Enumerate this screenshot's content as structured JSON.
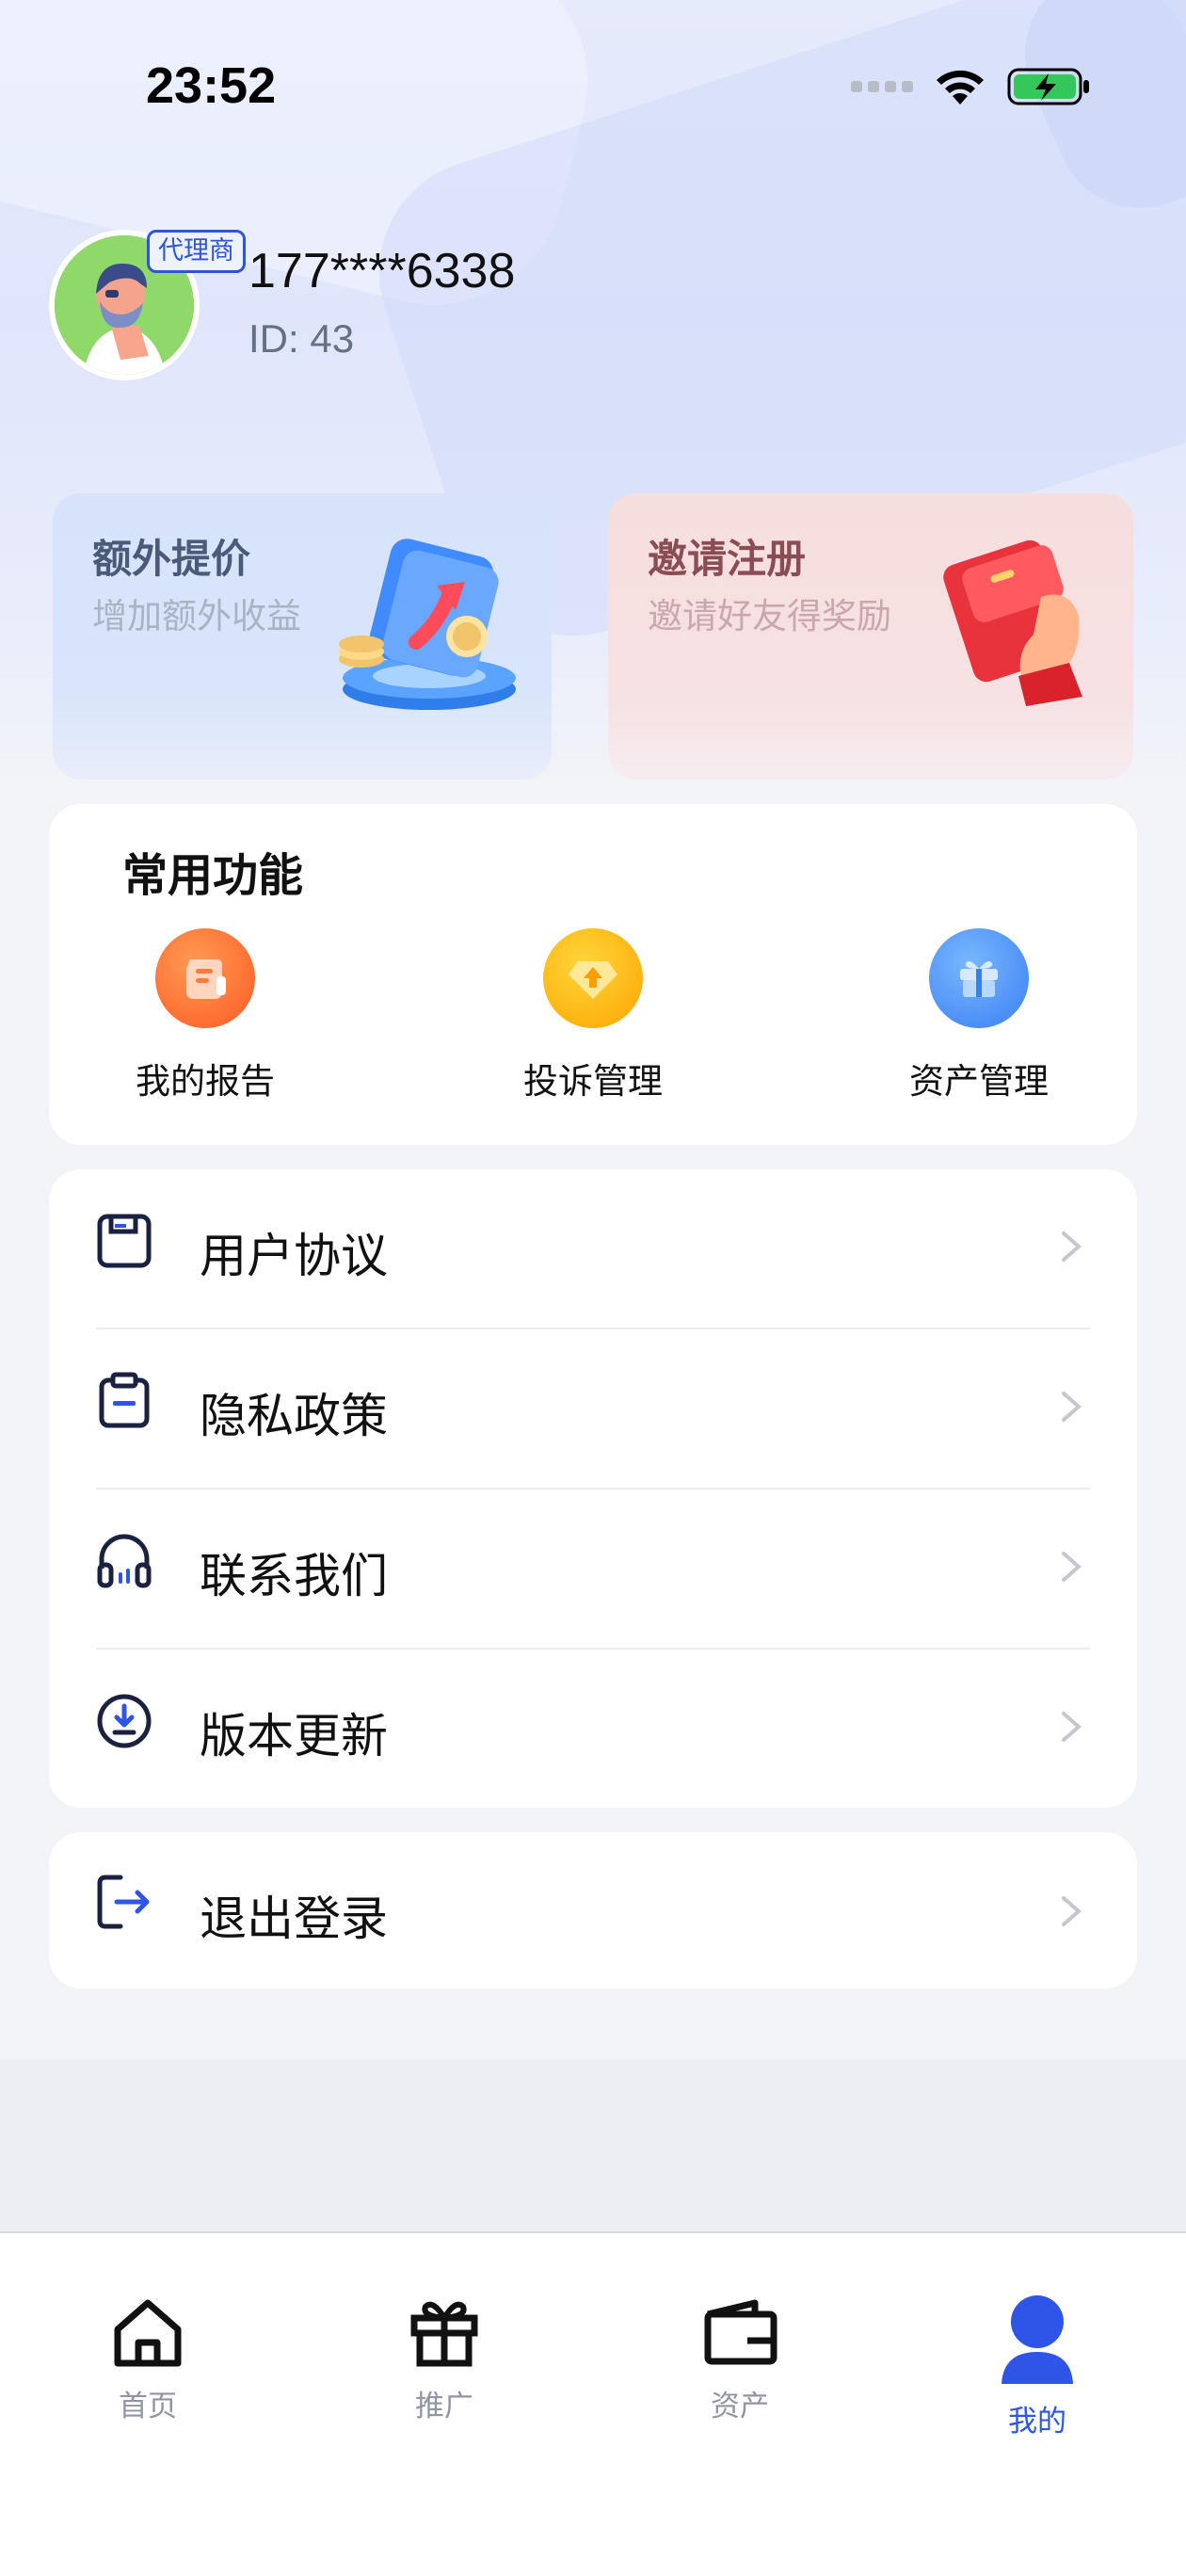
{
  "status_bar": {
    "time": "23:52"
  },
  "profile": {
    "badge": "代理商",
    "phone": "177****6338",
    "id_text": "ID: 43"
  },
  "promos": [
    {
      "title": "额外提价",
      "subtitle": "增加额外收益"
    },
    {
      "title": "邀请注册",
      "subtitle": "邀请好友得奖励"
    }
  ],
  "common_functions": {
    "title": "常用功能",
    "items": [
      {
        "label": "我的报告",
        "icon": "report-icon"
      },
      {
        "label": "投诉管理",
        "icon": "complaint-icon"
      },
      {
        "label": "资产管理",
        "icon": "gift-box-icon"
      }
    ]
  },
  "menu": [
    {
      "label": "用户协议",
      "icon": "agreement-icon"
    },
    {
      "label": "隐私政策",
      "icon": "clipboard-icon"
    },
    {
      "label": "联系我们",
      "icon": "headset-icon"
    },
    {
      "label": "版本更新",
      "icon": "download-icon"
    }
  ],
  "logout": {
    "label": "退出登录",
    "icon": "logout-icon"
  },
  "tabbar": {
    "items": [
      {
        "label": "首页",
        "icon": "home-icon"
      },
      {
        "label": "推广",
        "icon": "gift-icon"
      },
      {
        "label": "资产",
        "icon": "wallet-icon"
      },
      {
        "label": "我的",
        "icon": "user-icon"
      }
    ],
    "active_index": 3
  },
  "colors": {
    "accent": "#2f55e8",
    "report_orange": "#ff6a2a",
    "complaint_yellow": "#ffb300",
    "asset_blue": "#3d8cf5"
  }
}
